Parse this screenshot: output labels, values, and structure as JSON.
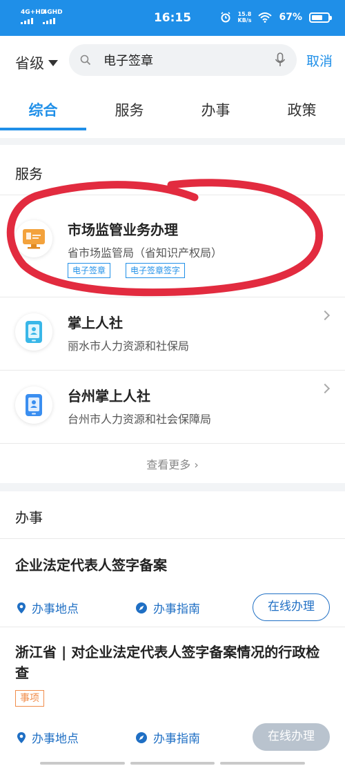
{
  "status_bar": {
    "signal_1": "4G+HD",
    "signal_2": "4GHD",
    "time": "16:15",
    "net_speed_value": "15.8",
    "net_speed_unit": "KB/s",
    "battery": "67%",
    "battery_level": 0.67
  },
  "search": {
    "region": "省级",
    "value": "电子签章",
    "cancel_label": "取消"
  },
  "tabs": [
    {
      "label": "综合",
      "active": true
    },
    {
      "label": "服务",
      "active": false
    },
    {
      "label": "办事",
      "active": false
    },
    {
      "label": "政策",
      "active": false
    }
  ],
  "services": {
    "section_title": "服务",
    "items": [
      {
        "name": "市场监管业务办理",
        "org": "省市场监管局（省知识产权局）",
        "icon": "market-supervision-icon",
        "tags": [
          "电子签章",
          "电子签章签字"
        ]
      },
      {
        "name": "掌上人社",
        "org": "丽水市人力资源和社保局",
        "icon": "mobile-social-security-icon"
      },
      {
        "name": "台州掌上人社",
        "org": "台州市人力资源和社会保障局",
        "icon": "mobile-social-security-icon"
      }
    ],
    "more_label": "查看更多"
  },
  "affairs": {
    "section_title": "办事",
    "items": [
      {
        "title": "企业法定代表人签字备案",
        "location_label": "办事地点",
        "guide_label": "办事指南",
        "online_label": "在线办理",
        "online_enabled": true
      },
      {
        "title": "浙江省 | 对企业法定代表人签字备案情况的行政检查",
        "badge": "事项",
        "location_label": "办事地点",
        "guide_label": "办事指南",
        "online_label": "在线办理",
        "online_enabled": false
      }
    ]
  },
  "colors": {
    "primary": "#1f8fe8",
    "link": "#1f6fc4",
    "badge": "#f08c4a",
    "annotation": "#e0192f"
  }
}
